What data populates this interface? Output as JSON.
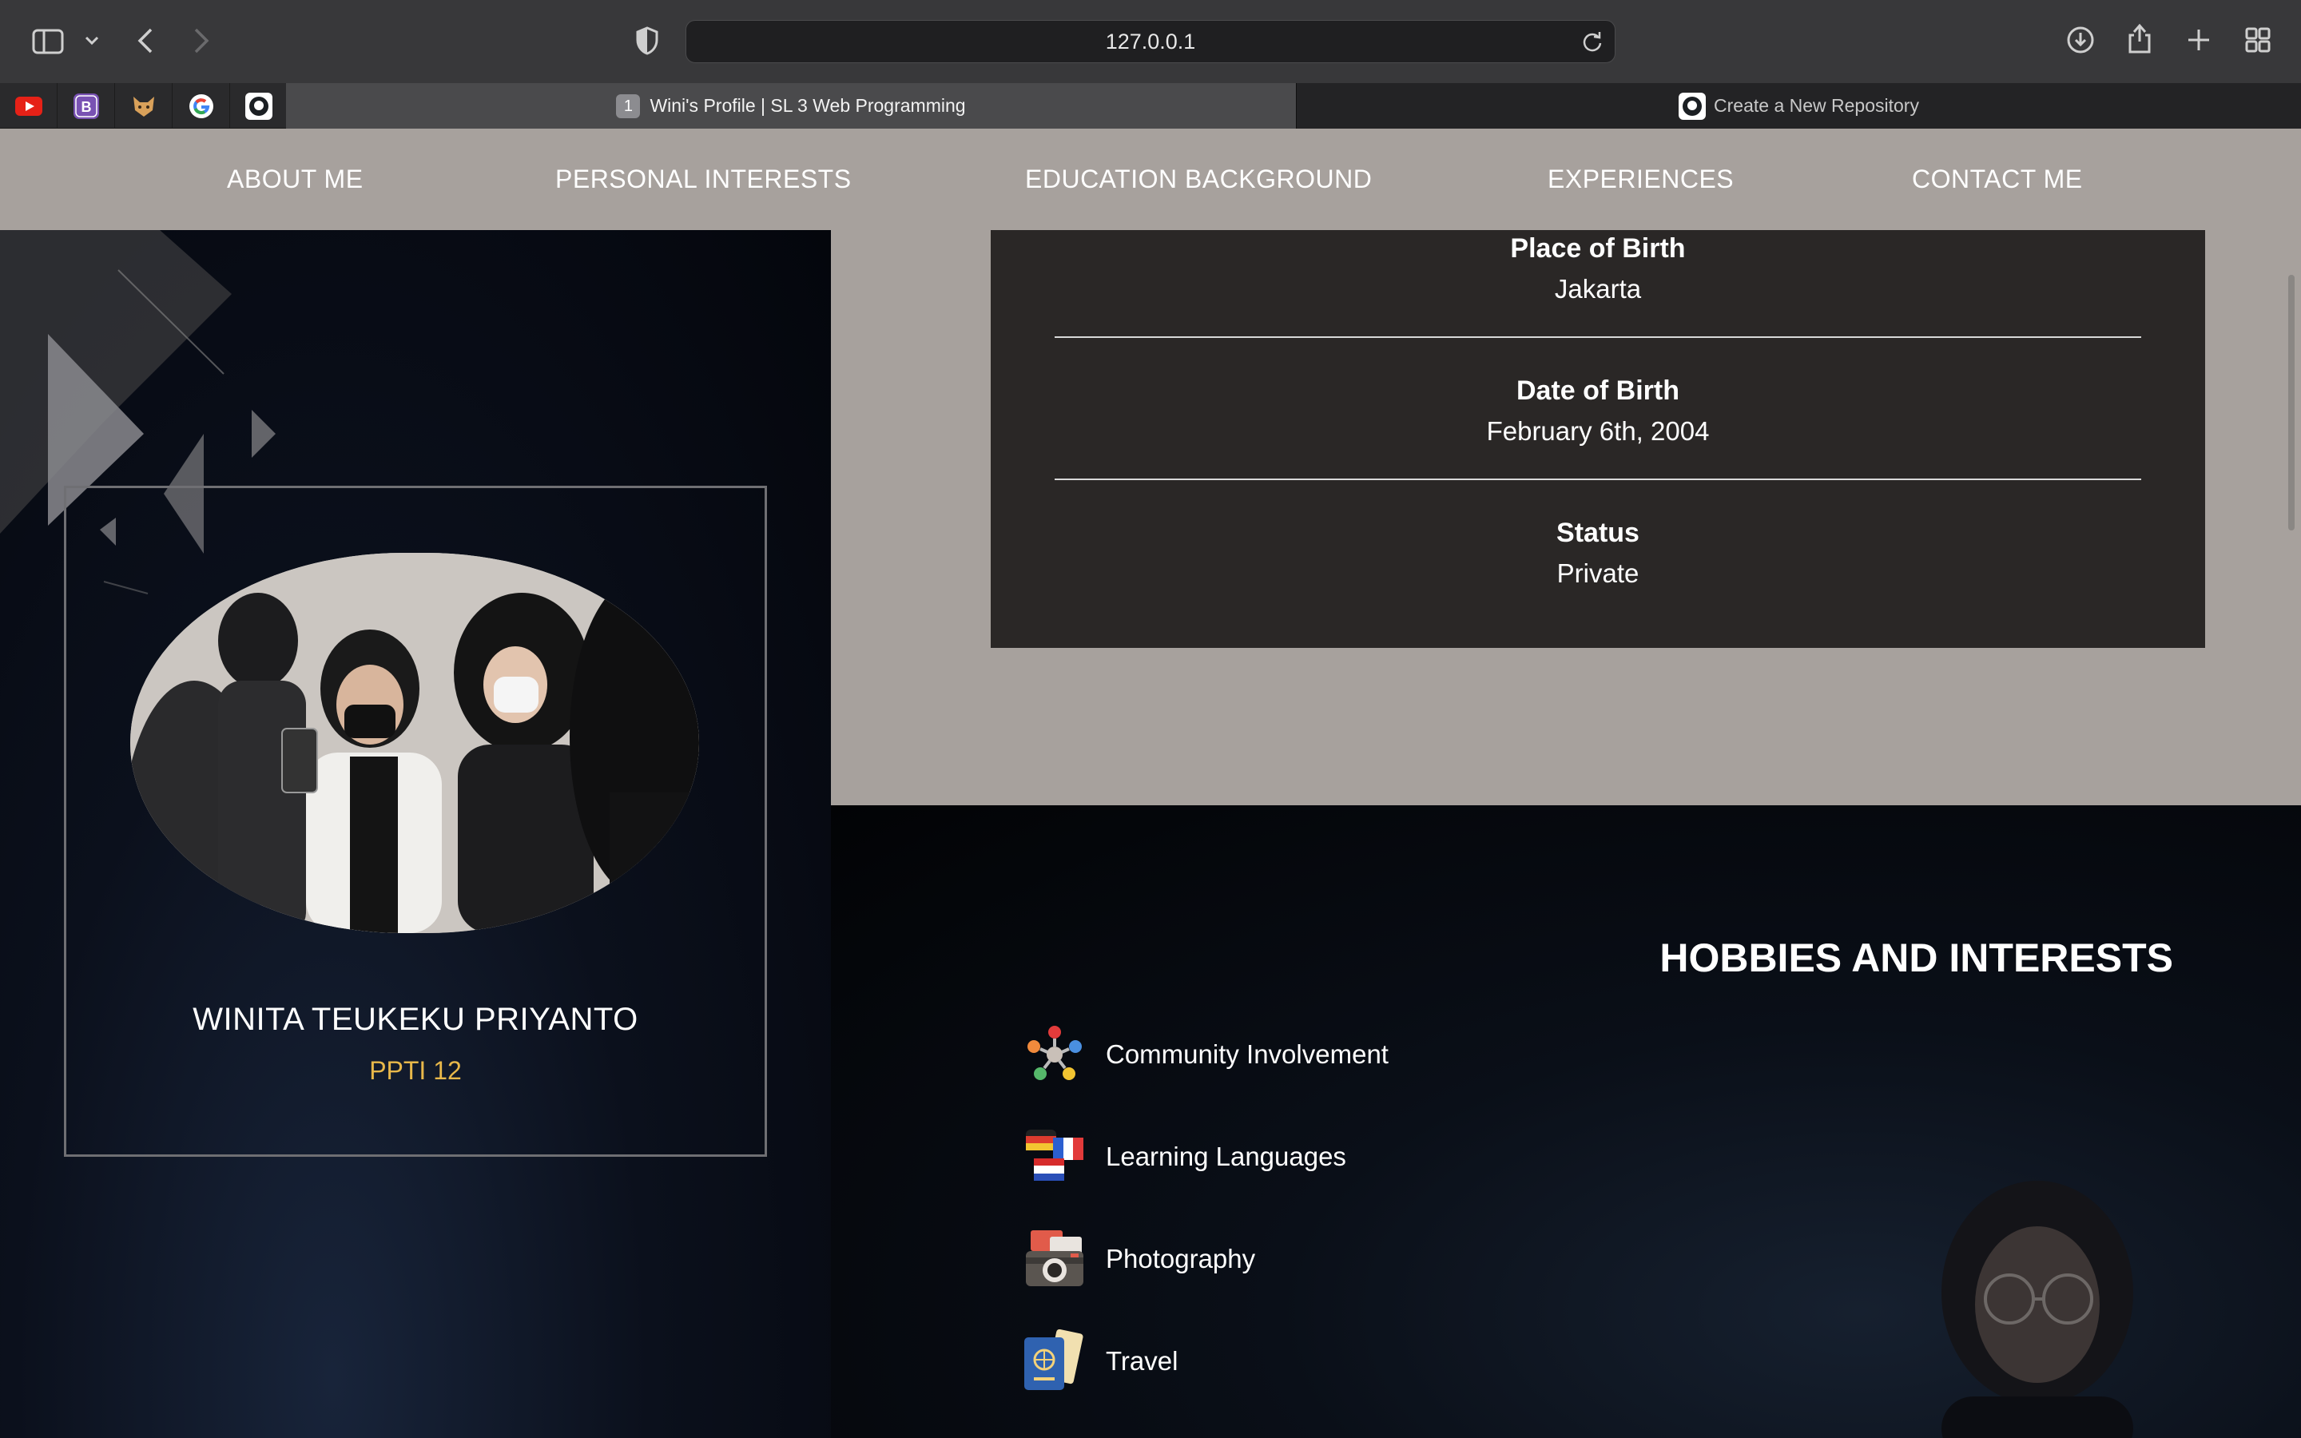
{
  "browser": {
    "url": "127.0.0.1",
    "tabs": [
      {
        "number": "1",
        "title": "Wini's Profile | SL 3 Web Programming",
        "active": true
      },
      {
        "title": "Create a New Repository",
        "active": false
      }
    ],
    "favorites": [
      "youtube-icon",
      "bootstrap-icon",
      "fox-icon",
      "google-icon",
      "github-icon"
    ]
  },
  "nav": {
    "items": [
      "ABOUT ME",
      "PERSONAL INTERESTS",
      "EDUCATION BACKGROUND",
      "EXPERIENCES",
      "CONTACT ME"
    ]
  },
  "profile": {
    "name": "WINITA TEUKEKU PRIYANTO",
    "class": "PPTI 12"
  },
  "info": {
    "items": [
      {
        "label": "Place of Birth",
        "value": "Jakarta"
      },
      {
        "label": "Date of Birth",
        "value": "February 6th, 2004"
      },
      {
        "label": "Status",
        "value": "Private"
      }
    ]
  },
  "hobbies": {
    "title": "HOBBIES AND INTERESTS",
    "items": [
      {
        "label": "Community Involvement",
        "icon": "community-icon"
      },
      {
        "label": "Learning Languages",
        "icon": "languages-icon"
      },
      {
        "label": "Photography",
        "icon": "camera-icon"
      },
      {
        "label": "Travel",
        "icon": "passport-icon"
      }
    ]
  },
  "colors": {
    "nav_bg": "#a7a19d",
    "info_bg": "#2a2726",
    "accent": "#e8b84a"
  }
}
